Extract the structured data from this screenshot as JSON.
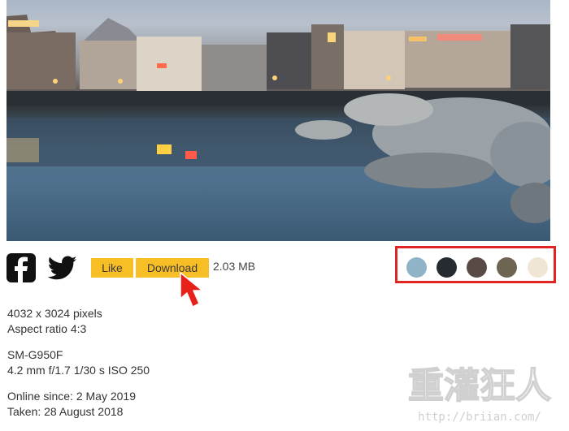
{
  "actions": {
    "like_label": "Like",
    "download_label": "Download",
    "file_size": "2.03 MB"
  },
  "icons": {
    "facebook": "facebook-icon",
    "twitter": "twitter-icon",
    "arrow": "red-arrow-pointer-icon"
  },
  "palette": {
    "colors": [
      "#8fb3c7",
      "#262b31",
      "#5a4a45",
      "#6e6452",
      "#f0e6d6"
    ]
  },
  "details": {
    "dimensions": "4032 x 3024 pixels",
    "aspect_ratio": "Aspect ratio 4:3",
    "camera": "SM-G950F",
    "exposure": "4.2 mm f/1.7 1/30 s ISO 250",
    "online_since": "Online since: 2 May 2019",
    "taken": "Taken: 28 August 2018"
  },
  "watermark": {
    "text": "重灌狂人",
    "url": "http://briian.com/"
  }
}
